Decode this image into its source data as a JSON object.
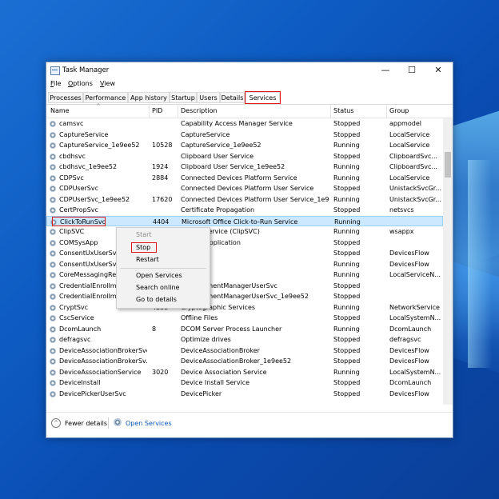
{
  "window": {
    "title": "Task Manager",
    "controls": {
      "minimize": "—",
      "maximize": "☐",
      "close": "✕"
    }
  },
  "menu": [
    {
      "label": "File",
      "underline": "F",
      "rest": "ile"
    },
    {
      "label": "Options",
      "underline": "O",
      "rest": "ptions"
    },
    {
      "label": "View",
      "underline": "V",
      "rest": "iew"
    }
  ],
  "tabs": [
    "Processes",
    "Performance",
    "App history",
    "Startup",
    "Users",
    "Details",
    "Services"
  ],
  "active_tab": "Services",
  "columns": {
    "name": "Name",
    "pid": "PID",
    "description": "Description",
    "status": "Status",
    "group": "Group"
  },
  "services": [
    {
      "name": "camsvc",
      "pid": "",
      "description": "Capability Access Manager Service",
      "status": "Stopped",
      "group": "appmodel"
    },
    {
      "name": "CaptureService",
      "pid": "",
      "description": "CaptureService",
      "status": "Stopped",
      "group": "LocalService"
    },
    {
      "name": "CaptureService_1e9ee52",
      "pid": "10528",
      "description": "CaptureService_1e9ee52",
      "status": "Running",
      "group": "LocalService"
    },
    {
      "name": "cbdhsvc",
      "pid": "",
      "description": "Clipboard User Service",
      "status": "Stopped",
      "group": "ClipboardSvc..."
    },
    {
      "name": "cbdhsvc_1e9ee52",
      "pid": "1924",
      "description": "Clipboard User Service_1e9ee52",
      "status": "Running",
      "group": "ClipboardSvc..."
    },
    {
      "name": "CDPSvc",
      "pid": "2884",
      "description": "Connected Devices Platform Service",
      "status": "Running",
      "group": "LocalService"
    },
    {
      "name": "CDPUserSvc",
      "pid": "",
      "description": "Connected Devices Platform User Service",
      "status": "Stopped",
      "group": "UnistackSvcGr..."
    },
    {
      "name": "CDPUserSvc_1e9ee52",
      "pid": "17620",
      "description": "Connected Devices Platform User Service_1e9e...",
      "status": "Running",
      "group": "UnistackSvcGr..."
    },
    {
      "name": "CertPropSvc",
      "pid": "",
      "description": "Certificate Propagation",
      "status": "Stopped",
      "group": "netsvcs"
    },
    {
      "name": "ClickToRunSvc",
      "pid": "4404",
      "description": "Microsoft Office Click-to-Run Service",
      "status": "Running",
      "group": ""
    },
    {
      "name": "ClipSVC",
      "pid": "",
      "description": "...ense Service (ClipSVC)",
      "status": "Running",
      "group": "wsappx"
    },
    {
      "name": "COMSysApp",
      "pid": "",
      "description": "...stem Application",
      "status": "Stopped",
      "group": ""
    },
    {
      "name": "ConsentUxUserSvc",
      "pid": "",
      "description": "...X",
      "status": "Stopped",
      "group": "DevicesFlow"
    },
    {
      "name": "ConsentUxUserSvc",
      "pid": "",
      "description": "...X",
      "status": "Running",
      "group": "DevicesFlow"
    },
    {
      "name": "CoreMessagingReg",
      "pid": "",
      "description": "...aging",
      "status": "Running",
      "group": "LocalServiceN..."
    },
    {
      "name": "CredentialEnrollme",
      "pid": "",
      "description": "...lEnrollmentManagerUserSvc",
      "status": "Stopped",
      "group": ""
    },
    {
      "name": "CredentialEnrollme",
      "pid": "",
      "description": "...lEnrollmentManagerUserSvc_1e9ee52",
      "status": "Stopped",
      "group": ""
    },
    {
      "name": "CryptSvc",
      "pid": "4252",
      "description": "Cryptographic Services",
      "status": "Running",
      "group": "NetworkService"
    },
    {
      "name": "CscService",
      "pid": "",
      "description": "Offline Files",
      "status": "Stopped",
      "group": "LocalSystemN..."
    },
    {
      "name": "DcomLaunch",
      "pid": "8",
      "description": "DCOM Server Process Launcher",
      "status": "Running",
      "group": "DcomLaunch"
    },
    {
      "name": "defragsvc",
      "pid": "",
      "description": "Optimize drives",
      "status": "Stopped",
      "group": "defragsvc"
    },
    {
      "name": "DeviceAssociationBrokerSvc",
      "pid": "",
      "description": "DeviceAssociationBroker",
      "status": "Stopped",
      "group": "DevicesFlow"
    },
    {
      "name": "DeviceAssociationBrokerSv...",
      "pid": "",
      "description": "DeviceAssociationBroker_1e9ee52",
      "status": "Stopped",
      "group": "DevicesFlow"
    },
    {
      "name": "DeviceAssociationService",
      "pid": "3020",
      "description": "Device Association Service",
      "status": "Running",
      "group": "LocalSystemN..."
    },
    {
      "name": "DeviceInstall",
      "pid": "",
      "description": "Device Install Service",
      "status": "Stopped",
      "group": "DcomLaunch"
    },
    {
      "name": "DevicePickerUserSvc",
      "pid": "",
      "description": "DevicePicker",
      "status": "Stopped",
      "group": "DevicesFlow"
    }
  ],
  "selected_service": "ClickToRunSvc",
  "context_menu": [
    "Start",
    "Stop",
    "Restart",
    "Open Services",
    "Search online",
    "Go to details"
  ],
  "footer": {
    "fewer_details": "Fewer details",
    "open_services": "Open Services"
  },
  "colors": {
    "highlight": "#e0161b",
    "selection": "#cce8ff",
    "link": "#0b57b8"
  }
}
